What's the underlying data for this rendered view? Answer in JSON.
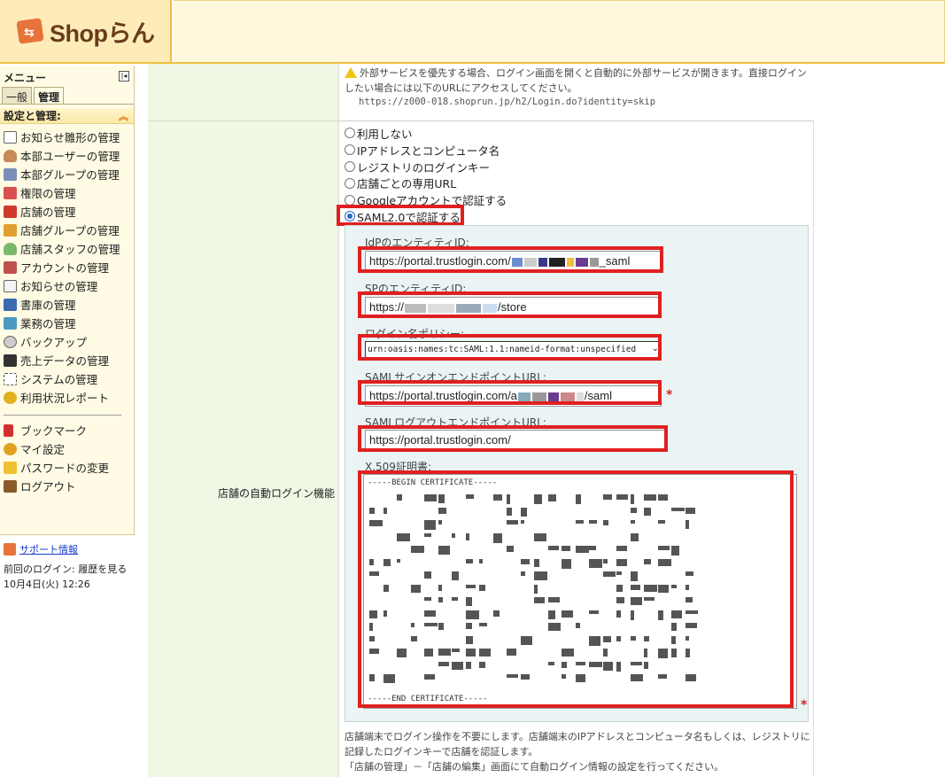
{
  "header": {
    "logo_text": "Shopらん"
  },
  "sidebar": {
    "menu_title": "メニュー",
    "collapse_icon": "collapse-left-icon",
    "tabs": [
      {
        "label": "一般"
      },
      {
        "label": "管理"
      }
    ],
    "section_title": "設定と管理:",
    "items": [
      {
        "label": "お知らせ雛形の管理",
        "icon": "document-icon"
      },
      {
        "label": "本部ユーザーの管理",
        "icon": "user-icon"
      },
      {
        "label": "本部グループの管理",
        "icon": "group-icon"
      },
      {
        "label": "権限の管理",
        "icon": "permission-icon"
      },
      {
        "label": "店舗の管理",
        "icon": "store-icon"
      },
      {
        "label": "店舗グループの管理",
        "icon": "store-group-icon"
      },
      {
        "label": "店舗スタッフの管理",
        "icon": "staff-icon"
      },
      {
        "label": "アカウントの管理",
        "icon": "account-icon"
      },
      {
        "label": "お知らせの管理",
        "icon": "notice-icon"
      },
      {
        "label": "書庫の管理",
        "icon": "archive-icon"
      },
      {
        "label": "業務の管理",
        "icon": "task-icon"
      },
      {
        "label": "バックアップ",
        "icon": "backup-icon"
      },
      {
        "label": "売上データの管理",
        "icon": "sales-icon"
      },
      {
        "label": "システムの管理",
        "icon": "system-icon"
      },
      {
        "label": "利用状況レポート",
        "icon": "report-icon"
      }
    ],
    "sub_items": [
      {
        "label": "ブックマーク",
        "icon": "bookmark-icon"
      },
      {
        "label": "マイ設定",
        "icon": "my-settings-icon"
      },
      {
        "label": "パスワードの変更",
        "icon": "lock-icon"
      },
      {
        "label": "ログアウト",
        "icon": "logout-icon"
      }
    ],
    "support_link": "サポート情報",
    "last_login_label": "前回のログイン:",
    "history_link": "履歴を見る",
    "last_login_time": "10月4日(火) 12:26"
  },
  "main": {
    "top_warning": "外部サービスを優先する場合、ログイン画面を開くと自動的に外部サービスが開きます。直接ログインしたい場合には以下のURLにアクセスしてください。",
    "top_url": "https://z000-018.shoprun.jp/h2/Login.do?identity=skip",
    "field_label": "店舗の自動ログイン機能",
    "radio_options": [
      {
        "label": "利用しない",
        "selected": false
      },
      {
        "label": "IPアドレスとコンピュータ名",
        "selected": false
      },
      {
        "label": "レジストリのログインキー",
        "selected": false
      },
      {
        "label": "店舗ごとの専用URL",
        "selected": false
      },
      {
        "label": "Googleアカウントで認証する",
        "selected": false
      },
      {
        "label": "SAML2.0で認証する",
        "selected": true
      }
    ],
    "saml": {
      "idp_entity_label": "IdPのエンティティID:",
      "idp_entity_prefix": "https://portal.trustlogin.com/",
      "idp_entity_suffix": "_saml",
      "sp_entity_label": "SPのエンティティID:",
      "sp_entity_prefix": "https://",
      "sp_entity_suffix": "/store",
      "nameid_label": "ログイン名ポリシー:",
      "nameid_value": "urn:oasis:names:tc:SAML:1.1:nameid-format:unspecified",
      "sso_url_label": "SAMLサインオンエンドポイントURL:",
      "sso_url_prefix": "https://portal.trustlogin.com/a",
      "sso_url_suffix": "/saml",
      "slo_url_label": "SAMLログアウトエンドポイントURL:",
      "slo_url_value": "https://portal.trustlogin.com/",
      "cert_label": "X.509証明書:",
      "cert_begin": "-----BEGIN CERTIFICATE-----",
      "cert_end": "-----END CERTIFICATE-----",
      "required_mark": "*"
    },
    "footnote_1": "店舗端末でログイン操作を不要にします。店舗端末のIPアドレスとコンピュータ名もしくは、レジストリに記録したログインキーで店舗を認証します。",
    "footnote_2": "「店舗の管理」－「店舗の編集」画面にて自動ログイン情報の設定を行ってください。"
  },
  "colors": {
    "highlight": "#e02020",
    "accent": "#f0c040",
    "label_bg": "#eef8e4",
    "panel_bg": "#eaf4f4"
  }
}
